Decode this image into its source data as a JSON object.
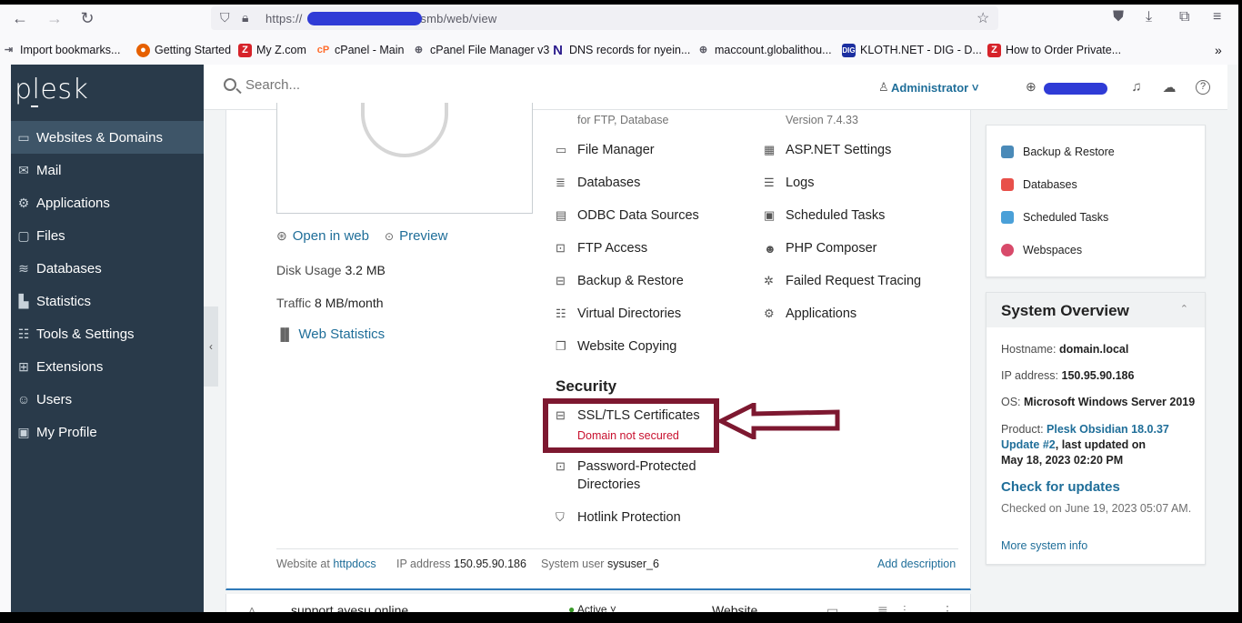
{
  "browser": {
    "url_prefix": "https://",
    "url_suffix": "/smb/web/view",
    "bookmarks": [
      {
        "label": "Import bookmarks...",
        "icon": "import-icon",
        "color": "#5b5b66"
      },
      {
        "label": "Getting Started",
        "icon": "firefox-icon",
        "color": "#e66000"
      },
      {
        "label": "My Z.com",
        "icon": "zcom-icon",
        "color": "#d6232a"
      },
      {
        "label": "cPanel - Main",
        "icon": "cpanel-icon",
        "color": "#ff6c2c"
      },
      {
        "label": "cPanel File Manager v3",
        "icon": "globe-icon",
        "color": "#5b5b66"
      },
      {
        "label": "DNS records for nyein...",
        "icon": "n-icon",
        "color": "#2b1b8c"
      },
      {
        "label": "maccount.globalithou...",
        "icon": "globe-icon",
        "color": "#5b5b66"
      },
      {
        "label": "KLOTH.NET - DIG - D...",
        "icon": "kloth-icon",
        "color": "#1c2fa0"
      },
      {
        "label": "How to Order Private...",
        "icon": "zcom-icon",
        "color": "#d6232a"
      }
    ]
  },
  "sidebar": {
    "logo": "plesk",
    "items": [
      {
        "label": "Websites & Domains",
        "icon": "monitor-icon",
        "glyph": "▭"
      },
      {
        "label": "Mail",
        "icon": "mail-icon",
        "glyph": "✉"
      },
      {
        "label": "Applications",
        "icon": "gear-icon",
        "glyph": "⚙"
      },
      {
        "label": "Files",
        "icon": "folder-icon",
        "glyph": "▢"
      },
      {
        "label": "Databases",
        "icon": "layers-icon",
        "glyph": "≋"
      },
      {
        "label": "Statistics",
        "icon": "bar-chart-icon",
        "glyph": "▙"
      },
      {
        "label": "Tools & Settings",
        "icon": "sliders-icon",
        "glyph": "☷"
      },
      {
        "label": "Extensions",
        "icon": "puzzle-icon",
        "glyph": "⊞"
      },
      {
        "label": "Users",
        "icon": "user-icon",
        "glyph": "☺"
      },
      {
        "label": "My Profile",
        "icon": "profile-icon",
        "glyph": "▣"
      }
    ]
  },
  "topbar": {
    "search_placeholder": "Search...",
    "admin_label": "Administrator ˅"
  },
  "site": {
    "open_in_web": "Open in web",
    "preview": "Preview",
    "disk_usage_label": "Disk Usage",
    "disk_usage_value": "3.2 MB",
    "traffic_label": "Traffic",
    "traffic_value": "8 MB/month",
    "web_statistics": "Web Statistics"
  },
  "tools": {
    "col1_caption": "for FTP, Database",
    "col2_caption": "Version 7.4.33",
    "col1": [
      {
        "label": "File Manager",
        "icon": "folder-icon",
        "glyph": "▭"
      },
      {
        "label": "Databases",
        "icon": "database-icon",
        "glyph": "≣"
      },
      {
        "label": "ODBC Data Sources",
        "icon": "odbc-icon",
        "glyph": "▤"
      },
      {
        "label": "FTP Access",
        "icon": "ftp-icon",
        "glyph": "⊡"
      },
      {
        "label": "Backup & Restore",
        "icon": "backup-icon",
        "glyph": "⊟"
      },
      {
        "label": "Virtual Directories",
        "icon": "directories-icon",
        "glyph": "☷"
      },
      {
        "label": "Website Copying",
        "icon": "copy-icon",
        "glyph": "❐"
      }
    ],
    "col2": [
      {
        "label": "ASP.NET Settings",
        "icon": "aspnet-icon",
        "glyph": "▦"
      },
      {
        "label": "Logs",
        "icon": "logs-icon",
        "glyph": "☰"
      },
      {
        "label": "Scheduled Tasks",
        "icon": "calendar-icon",
        "glyph": "▣"
      },
      {
        "label": "PHP Composer",
        "icon": "composer-icon",
        "glyph": "☻"
      },
      {
        "label": "Failed Request Tracing",
        "icon": "tracing-icon",
        "glyph": "✲"
      },
      {
        "label": "Applications",
        "icon": "gear-icon",
        "glyph": "⚙"
      }
    ],
    "security_title": "Security",
    "ssl_label": "SSL/TLS Certificates",
    "ssl_status": "Domain not secured",
    "pwd_label_1": "Password-Protected",
    "pwd_label_2": "Directories",
    "hotlink_label": "Hotlink Protection"
  },
  "footer": {
    "website_at": "Website at",
    "httpdocs": "httpdocs",
    "ip_label": "IP address",
    "ip_value": "150.95.90.186",
    "sysuser_label": "System user",
    "sysuser_value": "sysuser_6",
    "add_description": "Add description"
  },
  "next_row": {
    "domain": "support.ayesu.online",
    "status": "Active ˅",
    "type": "Website"
  },
  "right_links": [
    {
      "label": "Backup & Restore",
      "icon": "backup-icon",
      "color": "#4a8ab8"
    },
    {
      "label": "Databases",
      "icon": "database-icon",
      "color": "#e8504a"
    },
    {
      "label": "Scheduled Tasks",
      "icon": "calendar-icon",
      "color": "#4aa0d8"
    },
    {
      "label": "Webspaces",
      "icon": "webspaces-icon",
      "color": "#d84a6a"
    }
  ],
  "system_overview": {
    "title": "System Overview",
    "hostname_label": "Hostname:",
    "hostname_value": "domain.local",
    "ip_label": "IP address:",
    "ip_value": "150.95.90.186",
    "os_label": "OS:",
    "os_value": "Microsoft Windows Server 2019",
    "product_label": "Product:",
    "product_value_1": "Plesk Obsidian 18.0.37",
    "product_value_2": "Update #2",
    "product_updated": ", last updated on",
    "product_date": "May 18, 2023 02:20 PM",
    "check_updates": "Check for updates",
    "checked_on": "Checked on June 19, 2023 05:07 AM.",
    "more_info": "More system info"
  },
  "colors": {
    "sidebar_bg": "#293a4a",
    "link": "#1f6e99",
    "highlight_box": "#7d1830",
    "error_text": "#c8102e"
  }
}
